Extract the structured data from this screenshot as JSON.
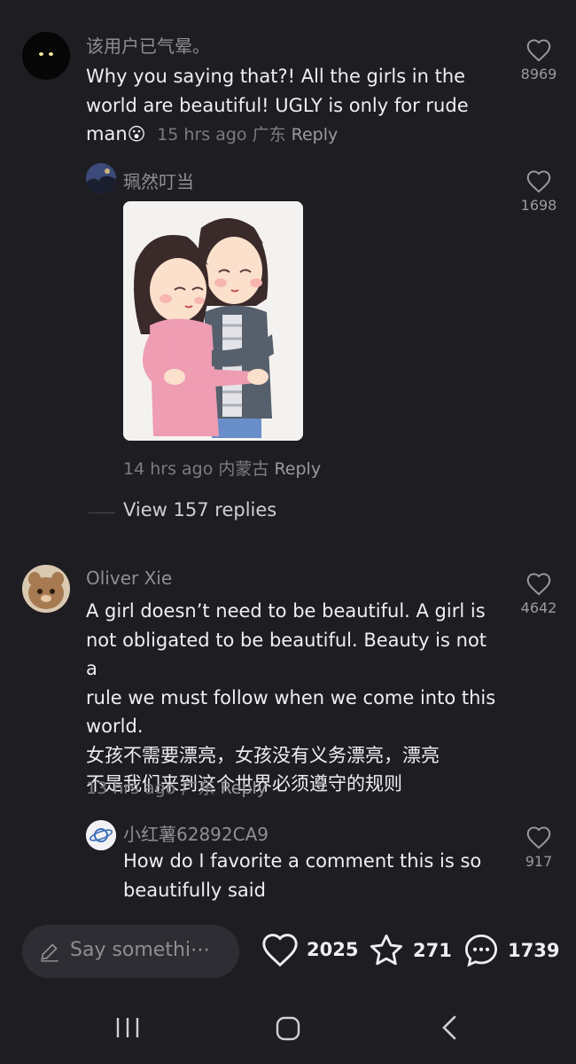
{
  "comments": [
    {
      "username": "该用户已气晕。",
      "text_lines": [
        "Why you saying that?! All the girls in the",
        "world are beautiful! UGLY is only for rude",
        "man"
      ],
      "emoji": "😮",
      "time": "15 hrs ago",
      "location": "广东",
      "reply_label": "Reply",
      "likes": "8969"
    },
    {
      "username": "珮然叮当",
      "time": "14 hrs ago",
      "location": "内蒙古",
      "reply_label": "Reply",
      "likes": "1698"
    },
    {
      "username": "Oliver Xie",
      "text_lines": [
        "A girl doesn’t need to be beautiful. A girl is",
        "not obligated to be beautiful. Beauty is not a",
        "rule we must follow when we come into this",
        "world.",
        "女孩不需要漂亮，女孩没有义务漂亮，漂亮",
        "不是我们来到这个世界必须遵守的规则"
      ],
      "time": "13 hrs ago",
      "location": "广东",
      "reply_label": "Reply",
      "likes": "4642"
    },
    {
      "username": "小红薯62892CA9",
      "text_lines": [
        "How do I favorite a comment this is so",
        "beautifully said"
      ],
      "likes": "917"
    }
  ],
  "view_replies": "View 157 replies",
  "bottom_bar": {
    "placeholder": "Say somethi⋯",
    "likes": "2025",
    "favorites": "271",
    "comments": "1739"
  },
  "colors": {
    "background": "#1e1d22",
    "text": "#efeff1",
    "muted": "#8e8e93"
  }
}
